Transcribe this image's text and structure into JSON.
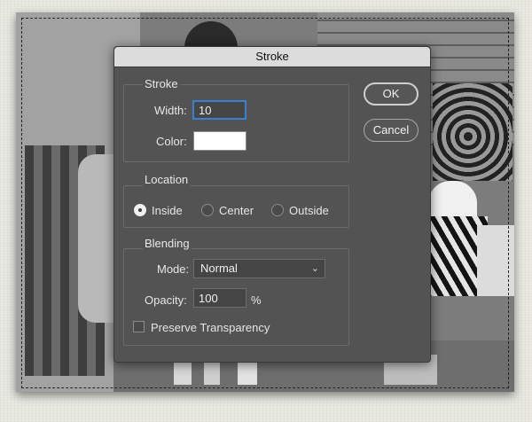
{
  "dialog": {
    "title": "Stroke"
  },
  "stroke": {
    "section_title": "Stroke",
    "width_label": "Width:",
    "width_value": "10",
    "color_label": "Color:",
    "color_value": "#ffffff"
  },
  "location": {
    "section_title": "Location",
    "options": [
      {
        "label": "Inside",
        "selected": true
      },
      {
        "label": "Center",
        "selected": false
      },
      {
        "label": "Outside",
        "selected": false
      }
    ]
  },
  "blending": {
    "section_title": "Blending",
    "mode_label": "Mode:",
    "mode_value": "Normal",
    "opacity_label": "Opacity:",
    "opacity_value": "100",
    "opacity_unit": "%",
    "preserve_label": "Preserve Transparency",
    "preserve_checked": false
  },
  "buttons": {
    "ok": "OK",
    "cancel": "Cancel"
  },
  "colors": {
    "dialog_bg": "#535353",
    "titlebar_bg": "#dcdcdc",
    "focus_ring": "#3b7fd3",
    "canvas_bg": "#e9e9e2"
  },
  "icons": {
    "mode_dropdown": "chevron-down-icon"
  }
}
